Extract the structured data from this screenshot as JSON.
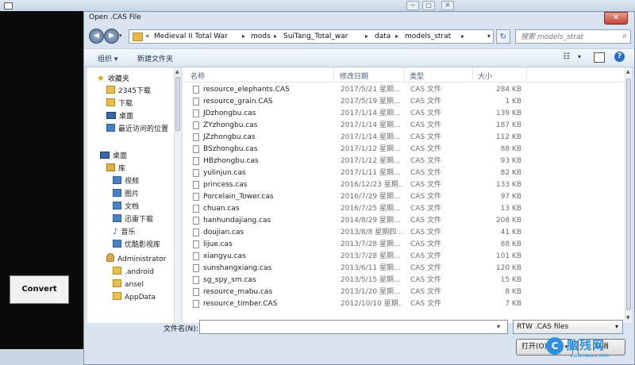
{
  "background_app": {
    "convert_label": "Convert",
    "title_controls": [
      "─",
      "□",
      "✕"
    ]
  },
  "dialog": {
    "title": "Open .CAS File",
    "close_glyph": "✕"
  },
  "address": {
    "more_glyph": "«",
    "crumbs": [
      "Medieval II Total War",
      "mods",
      "SuiTang_Total_war",
      "data",
      "models_strat"
    ],
    "separator": "▸",
    "search_placeholder": "搜索 models_strat"
  },
  "toolbar": {
    "organize_label": "组织 ▾",
    "new_folder_label": "新建文件夹"
  },
  "nav": {
    "items": [
      {
        "label": "收藏夹",
        "icon": "star-icon"
      },
      {
        "label": "2345下载",
        "icon": "folder-icon"
      },
      {
        "label": "下载",
        "icon": "download-folder-icon"
      },
      {
        "label": "桌面",
        "icon": "desktop-icon"
      },
      {
        "label": "最近访问的位置",
        "icon": "recent-places-icon"
      },
      {
        "label": "桌面",
        "icon": "desktop-icon"
      },
      {
        "label": "库",
        "icon": "library-icon"
      },
      {
        "label": "视频",
        "icon": "video-library-icon"
      },
      {
        "label": "图片",
        "icon": "pictures-library-icon"
      },
      {
        "label": "文档",
        "icon": "documents-library-icon"
      },
      {
        "label": "迅雷下载",
        "icon": "thunder-download-icon"
      },
      {
        "label": "音乐",
        "icon": "music-library-icon"
      },
      {
        "label": "优酷影视库",
        "icon": "youku-library-icon"
      },
      {
        "label": "Administrator",
        "icon": "user-folder-icon"
      },
      {
        "label": ".android",
        "icon": "folder-icon"
      },
      {
        "label": "ansel",
        "icon": "folder-icon"
      },
      {
        "label": "AppData",
        "icon": "folder-icon"
      }
    ]
  },
  "file_list": {
    "columns": {
      "name": "名称",
      "date": "修改日期",
      "type": "类型",
      "size": "大小"
    },
    "rows": [
      {
        "name": "resource_elephants.CAS",
        "date": "2017/5/21 星期...",
        "type": "CAS 文件",
        "size": "284 KB"
      },
      {
        "name": "resource_grain.CAS",
        "date": "2017/5/19 星期...",
        "type": "CAS 文件",
        "size": "1 KB"
      },
      {
        "name": "JDzhongbu.cas",
        "date": "2017/1/14 星期...",
        "type": "CAS 文件",
        "size": "139 KB"
      },
      {
        "name": "ZYzhongbu.cas",
        "date": "2017/1/14 星期...",
        "type": "CAS 文件",
        "size": "187 KB"
      },
      {
        "name": "JZzhongbu.cas",
        "date": "2017/1/14 星期...",
        "type": "CAS 文件",
        "size": "112 KB"
      },
      {
        "name": "BSzhongbu.cas",
        "date": "2017/1/12 星期...",
        "type": "CAS 文件",
        "size": "88 KB"
      },
      {
        "name": "HBzhongbu.cas",
        "date": "2017/1/12 星期...",
        "type": "CAS 文件",
        "size": "93 KB"
      },
      {
        "name": "yulinjun.cas",
        "date": "2017/1/11 星期...",
        "type": "CAS 文件",
        "size": "82 KB"
      },
      {
        "name": "princess.cas",
        "date": "2016/12/23 星期...",
        "type": "CAS 文件",
        "size": "133 KB"
      },
      {
        "name": "Porcelain_Tower.cas",
        "date": "2016/7/29 星期...",
        "type": "CAS 文件",
        "size": "97 KB"
      },
      {
        "name": "chuan.cas",
        "date": "2016/7/25 星期...",
        "type": "CAS 文件",
        "size": "13 KB"
      },
      {
        "name": "hanhundajiang.cas",
        "date": "2014/8/29 星期...",
        "type": "CAS 文件",
        "size": "208 KB"
      },
      {
        "name": "doujian.cas",
        "date": "2013/8/8 星期四 ...",
        "type": "CAS 文件",
        "size": "41 KB"
      },
      {
        "name": "lijue.cas",
        "date": "2013/7/28 星期...",
        "type": "CAS 文件",
        "size": "88 KB"
      },
      {
        "name": "xiangyu.cas",
        "date": "2013/7/28 星期...",
        "type": "CAS 文件",
        "size": "101 KB"
      },
      {
        "name": "sunshangxiang.cas",
        "date": "2013/6/11 星期...",
        "type": "CAS 文件",
        "size": "120 KB"
      },
      {
        "name": "sg_spy_sm.cas",
        "date": "2013/5/15 星期...",
        "type": "CAS 文件",
        "size": "15 KB"
      },
      {
        "name": "resource_mabu.cas",
        "date": "2013/1/20 星期...",
        "type": "CAS 文件",
        "size": "8 KB"
      },
      {
        "name": "resource_timber.CAS",
        "date": "2012/10/10 星期...",
        "type": "CAS 文件",
        "size": "7 KB"
      }
    ]
  },
  "bottom": {
    "filename_label": "文件名(N):",
    "filename_value": "",
    "filter_value": "RTW .CAS files",
    "open_label": "打开(O)",
    "cancel_label": "取消"
  },
  "watermark": {
    "text": "脑残网",
    "url": "www.naoxu.com"
  }
}
